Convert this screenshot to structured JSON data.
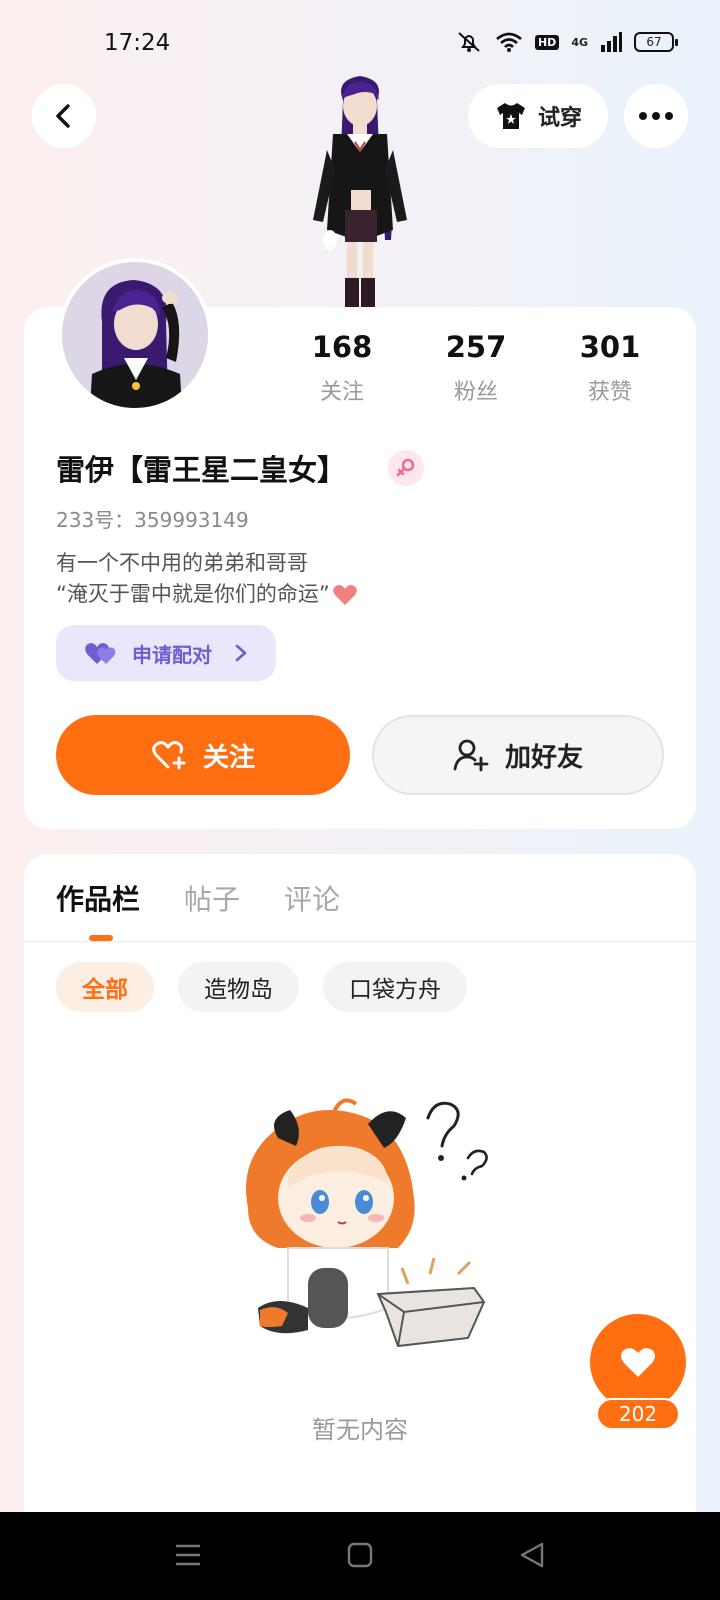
{
  "status_bar": {
    "time": "17:24",
    "hd": "HD",
    "network": "4G",
    "battery": "67"
  },
  "header": {
    "tryon_label": "试穿"
  },
  "stats": [
    {
      "value": "168",
      "label": "关注"
    },
    {
      "value": "257",
      "label": "粉丝"
    },
    {
      "value": "301",
      "label": "获赞"
    }
  ],
  "profile": {
    "name": "雷伊【雷王星二皇女】",
    "uid": "233号：359993149",
    "bio_line1": "有一个不中用的弟弟和哥哥",
    "bio_line2": "“淹灭于雷中就是你们的命运”"
  },
  "pair_button": {
    "label": "申请配对"
  },
  "actions": {
    "follow_label": "关注",
    "add_friend_label": "加好友"
  },
  "tabs": [
    "作品栏",
    "帖子",
    "评论"
  ],
  "chips": [
    "全部",
    "造物岛",
    "口袋方舟"
  ],
  "empty_text": "暂无内容",
  "like_count": "202",
  "colors": {
    "accent": "#ff6f12",
    "pair_purple": "#6d5fd3"
  }
}
